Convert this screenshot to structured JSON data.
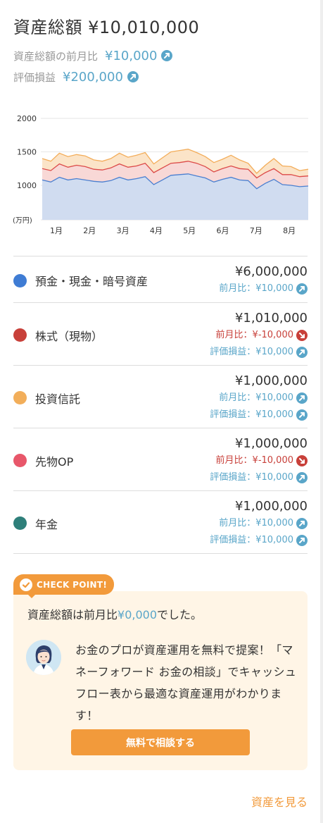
{
  "header": {
    "title": "資産総額 ¥10,010,000",
    "mom_label": "資産総額の前月比",
    "mom_value": "¥10,000",
    "pl_label": "評価損益",
    "pl_value": "¥200,000"
  },
  "chart_data": {
    "type": "area",
    "y_unit_label": "(万円)",
    "y_ticks": [
      "2000",
      "1500",
      "1000"
    ],
    "ylim": [
      0,
      2000
    ],
    "x_tick_labels": [
      "1月",
      "2月",
      "3月",
      "4月",
      "5月",
      "6月",
      "7月",
      "8月"
    ],
    "grid": true,
    "stacked": true,
    "colors": {
      "base_fill": "#d0dcf0",
      "base_line": "#4a7fd0",
      "mid_fill": "#f8d8d6",
      "mid_line": "#dc4a48",
      "top_fill": "#fbe4c8",
      "top_line": "#f3ad5a"
    },
    "series": [
      {
        "role": "base",
        "values": [
          1080,
          1050,
          1120,
          1080,
          1100,
          1080,
          1060,
          1050,
          1070,
          1120,
          1080,
          1100,
          1130,
          1010,
          1080,
          1150,
          1160,
          1170,
          1140,
          1110,
          1050,
          1090,
          1120,
          1080,
          1070,
          950,
          1030,
          1090,
          1010,
          1000,
          980,
          990
        ]
      },
      {
        "role": "mid",
        "values": [
          1250,
          1220,
          1320,
          1270,
          1300,
          1280,
          1240,
          1230,
          1260,
          1320,
          1270,
          1290,
          1330,
          1190,
          1260,
          1330,
          1340,
          1360,
          1330,
          1280,
          1200,
          1250,
          1290,
          1250,
          1240,
          1110,
          1190,
          1250,
          1160,
          1160,
          1130,
          1140
        ]
      },
      {
        "role": "top",
        "values": [
          1400,
          1360,
          1480,
          1430,
          1460,
          1440,
          1380,
          1360,
          1400,
          1480,
          1420,
          1450,
          1490,
          1320,
          1410,
          1500,
          1520,
          1540,
          1490,
          1430,
          1340,
          1390,
          1450,
          1380,
          1330,
          1180,
          1300,
          1400,
          1290,
          1280,
          1220,
          1240
        ]
      }
    ]
  },
  "assets": [
    {
      "name": "預金・現金・暗号資産",
      "color": "#3f7cd4",
      "amount": "¥6,000,000",
      "mom": "前月比：¥10,000",
      "mom_trend": "up"
    },
    {
      "name": "株式（現物）",
      "color": "#c8403a",
      "amount": "¥1,010,000",
      "mom": "前月比：¥-10,000",
      "mom_trend": "down",
      "pl": "評価損益：¥10,000",
      "pl_trend": "up"
    },
    {
      "name": "投資信託",
      "color": "#f2ae5a",
      "amount": "¥1,000,000",
      "mom": "前月比：¥10,000",
      "mom_trend": "up",
      "pl": "評価損益：¥10,000",
      "pl_trend": "up"
    },
    {
      "name": "先物OP",
      "color": "#e8576a",
      "amount": "¥1,000,000",
      "mom": "前月比：¥-10,000",
      "mom_trend": "down",
      "pl": "評価損益：¥10,000",
      "pl_trend": "up"
    },
    {
      "name": "年金",
      "color": "#2e7f7a",
      "amount": "¥1,000,000",
      "mom": "前月比：¥10,000",
      "mom_trend": "up",
      "pl": "評価損益：¥10,000",
      "pl_trend": "up"
    }
  ],
  "check_point": {
    "tag": "CHECK POINT!",
    "summary_prefix": "資産総額は前月比",
    "summary_value": "¥0,000",
    "summary_suffix": "でした。",
    "message": "お金のプロが資産運用を無料で提案！「マネーフォワード お金の相談」でキャッシュフロー表から最適な資産運用がわかります！",
    "button": "無料で相談する"
  },
  "footer": {
    "see_assets": "資産を見る"
  },
  "icons": {
    "up_arrow": "arrow-up-right-icon",
    "down_arrow": "arrow-down-right-icon",
    "check": "check-circle-icon",
    "advisor": "advisor-avatar"
  }
}
